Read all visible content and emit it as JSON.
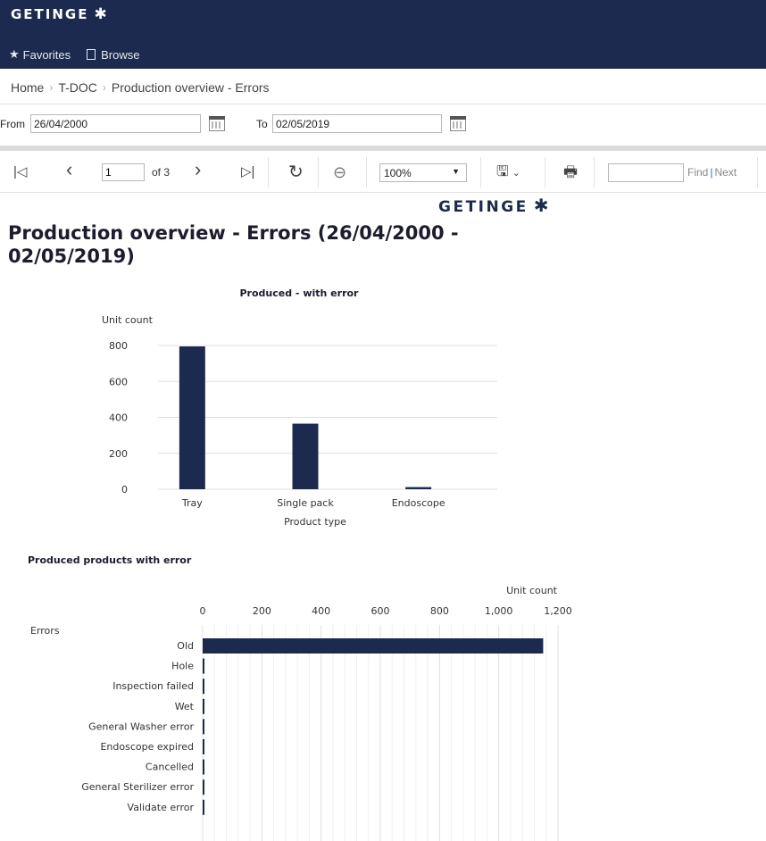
{
  "app": {
    "logo_text": "GETINGE",
    "nav": {
      "favorites": "Favorites",
      "browse": "Browse"
    }
  },
  "breadcrumb": {
    "home": "Home",
    "tdoc": "T-DOC",
    "current": "Production overview - Errors"
  },
  "params": {
    "from_label": "From",
    "from_value": "26/04/2000",
    "to_label": "To",
    "to_value": "02/05/2019"
  },
  "toolbar": {
    "page_value": "1",
    "of_label": "of 3",
    "zoom_value": "100%",
    "find_label": "Find",
    "next_label": "Next"
  },
  "report": {
    "logo_text": "GETINGE",
    "title": "Production overview - Errors (26/04/2000 - 02/05/2019)"
  },
  "colors": {
    "header": "#1b2a4e",
    "bar": "#1b2a4e",
    "link_separator": "#1e73be"
  },
  "chart_data": [
    {
      "type": "bar",
      "title": "Produced - with error",
      "ylabel": "Unit count",
      "xlabel": "Product type",
      "categories": [
        "Tray",
        "Single pack",
        "Endoscope"
      ],
      "values": [
        795,
        365,
        12
      ],
      "ylim": [
        0,
        800
      ],
      "yticks": [
        "0",
        "200",
        "400",
        "600",
        "800"
      ],
      "grid": true
    },
    {
      "type": "bar",
      "orientation": "horizontal",
      "title": "Produced products with error",
      "xlabel": "Unit count",
      "ylabel": "Errors",
      "categories": [
        "Old",
        "Hole",
        "Inspection failed",
        "Wet",
        "General Washer error",
        "Endoscope expired",
        "Cancelled",
        "General Sterilizer error",
        "Validate error"
      ],
      "values": [
        1150,
        6,
        5,
        5,
        3,
        3,
        2,
        2,
        2
      ],
      "xlim": [
        0,
        1200
      ],
      "xticks": [
        "0",
        "200",
        "400",
        "600",
        "800",
        "1,000",
        "1,200"
      ],
      "grid": true
    }
  ]
}
